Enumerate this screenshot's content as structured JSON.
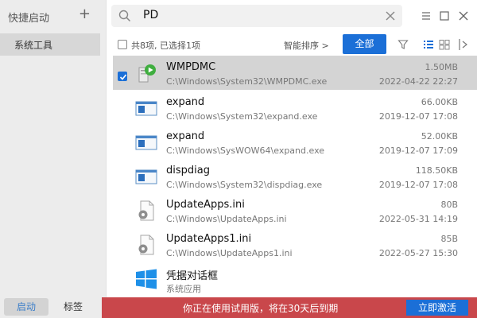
{
  "sidebar": {
    "title": "快捷启动",
    "add_symbol": "+",
    "items": [
      {
        "label": "系统工具"
      }
    ],
    "tabs": [
      {
        "label": "启动"
      },
      {
        "label": "标签"
      }
    ]
  },
  "search": {
    "query": "PD"
  },
  "window_controls": [
    "menu-icon",
    "maximize-icon",
    "close-icon"
  ],
  "toolbar": {
    "count_text": "共8项, 已选择1项",
    "sort_label": "智能排序 >",
    "filter_all_label": "全部"
  },
  "results": [
    {
      "name": "WMPDMC",
      "path": "C:\\Windows\\System32\\WMPDMC.exe",
      "size": "1.50MB",
      "date": "2022-04-22 22:27",
      "icon": "media-exe-icon",
      "selected": true
    },
    {
      "name": "expand",
      "path": "C:\\Windows\\System32\\expand.exe",
      "size": "66.00KB",
      "date": "2019-12-07 17:08",
      "icon": "exe-window-icon"
    },
    {
      "name": "expand",
      "path": "C:\\Windows\\SysWOW64\\expand.exe",
      "size": "52.00KB",
      "date": "2019-12-07 17:09",
      "icon": "exe-window-icon"
    },
    {
      "name": "dispdiag",
      "path": "C:\\Windows\\System32\\dispdiag.exe",
      "size": "118.50KB",
      "date": "2019-12-07 17:08",
      "icon": "exe-window-icon"
    },
    {
      "name": "UpdateApps.ini",
      "path": "C:\\Windows\\UpdateApps.ini",
      "size": "80B",
      "date": "2022-05-31 14:19",
      "icon": "settings-file-icon"
    },
    {
      "name": "UpdateApps1.ini",
      "path": "C:\\Windows\\UpdateApps1.ini",
      "size": "85B",
      "date": "2022-05-27 15:30",
      "icon": "settings-file-icon"
    },
    {
      "name": "凭据对话框",
      "path": "系统应用",
      "size": "",
      "date": "",
      "icon": "windows-logo-icon"
    }
  ],
  "banner": {
    "message": "你正在使用试用版，将在30天后到期",
    "button_label": "立即激活"
  },
  "colors": {
    "accent": "#1b6fd7",
    "banner": "#c9474b",
    "selected_row": "#d4d4d4",
    "sidebar": "#ececec"
  }
}
